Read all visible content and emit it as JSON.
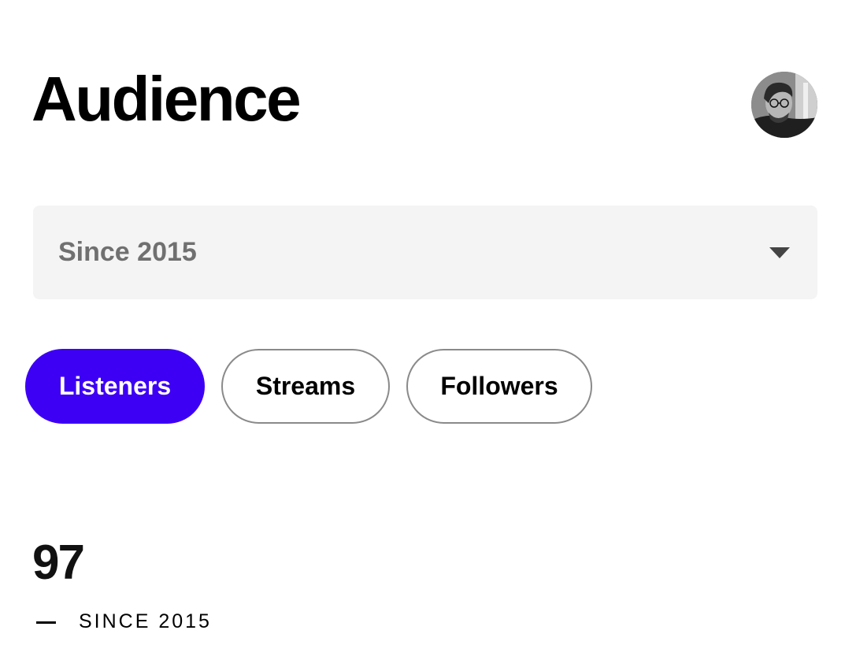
{
  "header": {
    "title": "Audience",
    "avatar_icon": "user-avatar-photo"
  },
  "filter": {
    "selected": "Since 2015",
    "dropdown_icon": "caret-down-icon"
  },
  "tabs": [
    {
      "label": "Listeners",
      "active": true
    },
    {
      "label": "Streams",
      "active": false
    },
    {
      "label": "Followers",
      "active": false
    }
  ],
  "stat": {
    "value": "97",
    "caption": "SINCE 2015"
  },
  "colors": {
    "accent": "#3d00f5",
    "select_bg": "#f4f4f4",
    "select_text": "#707070",
    "chip_border": "#8a8a8a"
  }
}
